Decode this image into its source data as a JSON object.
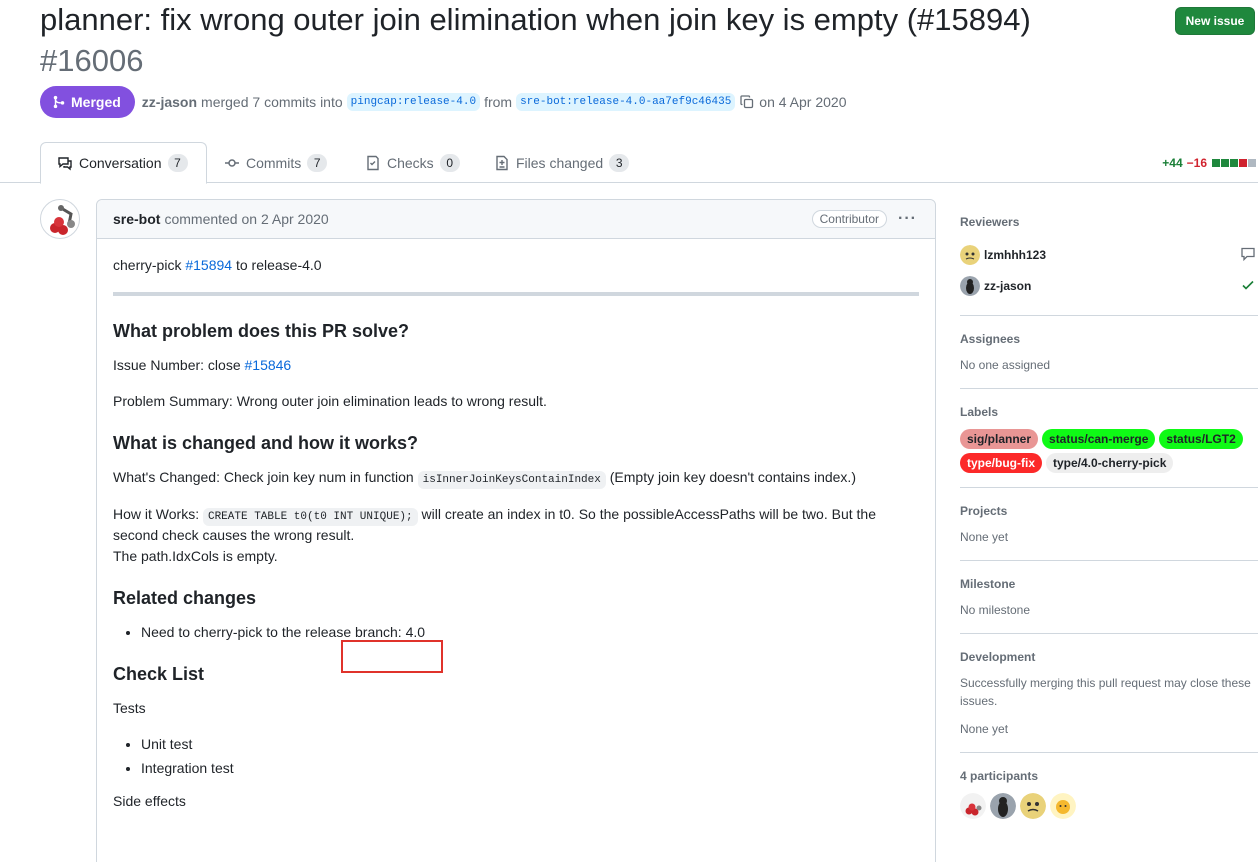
{
  "header": {
    "title": "planner: fix wrong outer join elimination when join key is empty (#15894)",
    "number": "#16006",
    "new_issue": "New issue",
    "status": "Merged",
    "author": "zz-jason",
    "merged_text": "merged 7 commits into",
    "base_branch": "pingcap:release-4.0",
    "from_text": "from",
    "head_branch": "sre-bot:release-4.0-aa7ef9c46435",
    "date_text": "on 4 Apr 2020"
  },
  "tabs": [
    {
      "label": "Conversation",
      "count": "7"
    },
    {
      "label": "Commits",
      "count": "7"
    },
    {
      "label": "Checks",
      "count": "0"
    },
    {
      "label": "Files changed",
      "count": "3"
    }
  ],
  "diffstat": {
    "additions": "+44",
    "deletions": "−16"
  },
  "comment": {
    "author": "sre-bot",
    "action": "commented on 2 Apr 2020",
    "badge": "Contributor",
    "intro_prefix": "cherry-pick",
    "intro_link": "#15894",
    "intro_suffix": "to release-4.0",
    "h_problem": "What problem does this PR solve?",
    "issue_prefix": "Issue Number: close",
    "issue_link": "#15846",
    "problem_summary": "Problem Summary: Wrong outer join elimination leads to wrong result.",
    "h_changed": "What is changed and how it works?",
    "changed_prefix": "What's Changed: Check join key num in function",
    "changed_code": "isInnerJoinKeysContainIndex",
    "changed_suffix": "(Empty join key doesn't contains index.)",
    "how_prefix": "How it Works:",
    "how_code": "CREATE TABLE t0(t0 INT UNIQUE);",
    "how_suffix": "will create an index in t0. So the possibleAccessPaths will be two. But the second check causes the wrong result.",
    "how_line2": "The path.IdxCols is empty.",
    "h_related": "Related changes",
    "related_item": "Need to cherry-pick to the release branch: 4.0",
    "h_checklist": "Check List",
    "tests_label": "Tests",
    "tests": [
      "Unit test",
      "Integration test"
    ],
    "side_effects": "Side effects"
  },
  "sidebar": {
    "reviewers_title": "Reviewers",
    "reviewers": [
      {
        "name": "lzmhhh123",
        "status": "comment-icon"
      },
      {
        "name": "zz-jason",
        "status": "check-icon"
      }
    ],
    "assignees_title": "Assignees",
    "assignees_text": "No one assigned",
    "labels_title": "Labels",
    "labels": [
      {
        "text": "sig/planner",
        "bg": "#e99695",
        "fg": "#1f2328"
      },
      {
        "text": "status/can-merge",
        "bg": "#0ffa16",
        "fg": "#1f2328"
      },
      {
        "text": "status/LGT2",
        "bg": "#0ffa16",
        "fg": "#1f2328"
      },
      {
        "text": "type/bug-fix",
        "bg": "#fc2929",
        "fg": "#ffffff"
      },
      {
        "text": "type/4.0-cherry-pick",
        "bg": "#eeeeee",
        "fg": "#1f2328"
      }
    ],
    "projects_title": "Projects",
    "projects_text": "None yet",
    "milestone_title": "Milestone",
    "milestone_text": "No milestone",
    "development_title": "Development",
    "development_text": "Successfully merging this pull request may close these issues.",
    "development_none": "None yet",
    "participants_title": "4 participants"
  },
  "colors": {
    "merged": "#8250df",
    "new_issue": "#1f883d",
    "link": "#0969da",
    "highlight": "#e0322b"
  }
}
